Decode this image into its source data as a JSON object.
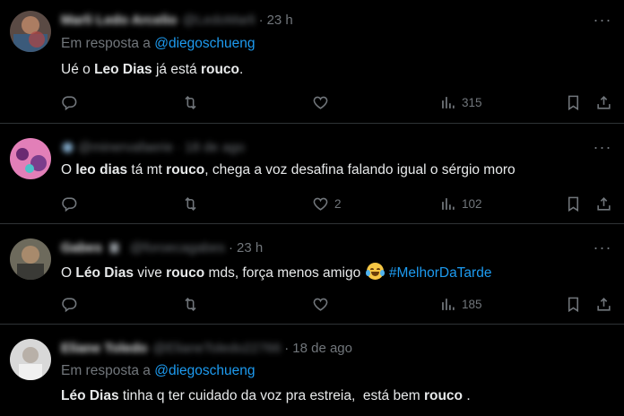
{
  "tweets": [
    {
      "name": "Marli Ledo Arcelio",
      "handle": "@LedoMarli",
      "time": "23 h",
      "reply_prefix": "Em resposta a",
      "reply_to": "@diegoschueng",
      "text_parts": [
        "Ué o ",
        "Leo Dias",
        " já está ",
        "rouco",
        "."
      ],
      "replies": "",
      "retweets": "",
      "likes": "",
      "views": "315"
    },
    {
      "name": "",
      "handle": "@minervafaerie",
      "time": "18 de ago",
      "text_parts": [
        "O ",
        "leo dias",
        " tá mt ",
        "rouco",
        ", chega a voz desafina falando igual o sérgio moro"
      ],
      "replies": "",
      "retweets": "",
      "likes": "2",
      "views": "102"
    },
    {
      "name": "Gabes",
      "handle": "@foroecagabes",
      "time": "23 h",
      "text_parts": [
        "O ",
        "Léo Dias",
        " vive ",
        "rouco",
        " mds, força menos amigo "
      ],
      "hashtag": "#MelhorDaTarde",
      "emoji": "face-with-tears-of-joy",
      "replies": "",
      "retweets": "",
      "likes": "",
      "views": "185"
    },
    {
      "name": "Eliane Toledo",
      "handle": "@ElianeToledo22766",
      "time": "18 de ago",
      "reply_prefix": "Em resposta a",
      "reply_to": "@diegoschueng",
      "text_parts": [
        "Léo Dias",
        " tinha q ter cuidado da voz pra estreia,  está bem ",
        "rouco",
        " ."
      ]
    }
  ],
  "colors": {
    "background": "#000000",
    "text": "#e7e9ea",
    "muted": "#71767b",
    "link": "#1d9bf0",
    "divider": "#2f3336"
  },
  "icons": {
    "reply": "reply-icon",
    "retweet": "retweet-icon",
    "like": "heart-icon",
    "views": "views-icon",
    "bookmark": "bookmark-icon",
    "share": "share-icon",
    "more": "more-icon"
  }
}
